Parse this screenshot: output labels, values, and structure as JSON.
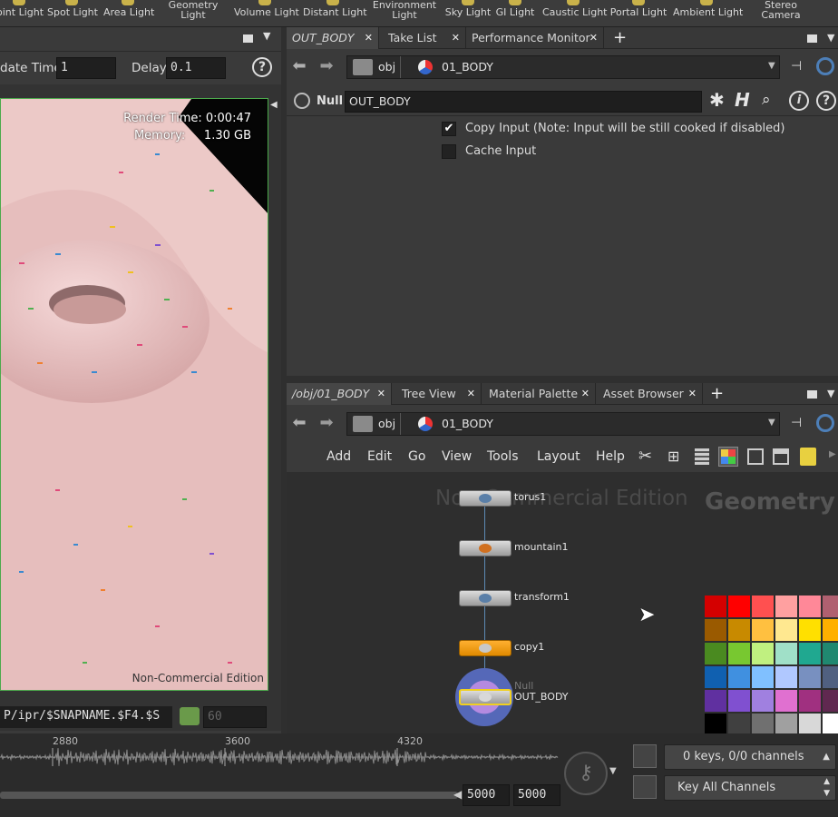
{
  "shelf": {
    "tools": [
      {
        "label": "Point Light",
        "visible": "oint Light"
      },
      {
        "label": "Spot Light"
      },
      {
        "label": "Area Light"
      },
      {
        "label": "Geometry Light",
        "l1": "Geometry",
        "l2": "Light"
      },
      {
        "label": "Volume Light"
      },
      {
        "label": "Distant Light"
      },
      {
        "label": "Environment Light",
        "l1": "Environment",
        "l2": "Light"
      },
      {
        "label": "Sky Light"
      },
      {
        "label": "GI Light"
      },
      {
        "label": "Caustic Light"
      },
      {
        "label": "Portal Light"
      },
      {
        "label": "Ambient Light"
      },
      {
        "label": "Stereo Camera",
        "l1": "Stereo",
        "l2": "Camera"
      }
    ]
  },
  "render": {
    "update_time_label": "date Time",
    "update_time_value": "1",
    "delay_label": "Delay",
    "delay_value": "0.1",
    "help_glyph": "?",
    "render_time_label": "Render Time:",
    "render_time_value": "0:00:47",
    "memory_label": "Memory:",
    "memory_value": "1.30 GB",
    "watermark": "Non-Commercial Edition",
    "output_path": "P/ipr/$SNAPNAME.$F4.$S",
    "frame_value": "60"
  },
  "top_pane": {
    "tabs": [
      {
        "label": "OUT_BODY",
        "active": true
      },
      {
        "label": "Take List"
      },
      {
        "label": "Performance Monitor"
      }
    ],
    "path": {
      "root": "obj",
      "node": "01_BODY"
    },
    "node_type": "Null",
    "node_name": "OUT_BODY",
    "params": [
      {
        "label": "Copy Input (Note: Input will be still cooked if disabled)",
        "checked": true
      },
      {
        "label": "Cache Input",
        "checked": false
      }
    ]
  },
  "bottom_pane": {
    "tabs": [
      {
        "label": "/obj/01_BODY",
        "active": true
      },
      {
        "label": "Tree View"
      },
      {
        "label": "Material Palette"
      },
      {
        "label": "Asset Browser"
      }
    ],
    "path": {
      "root": "obj",
      "node": "01_BODY"
    },
    "menu": [
      "Add",
      "Edit",
      "Go",
      "View",
      "Tools",
      "Layout",
      "Help"
    ],
    "watermark": "Non-Commercial Edition",
    "context_label": "Geometry",
    "nodes": [
      {
        "name": "torus1"
      },
      {
        "name": "mountain1"
      },
      {
        "name": "transform1"
      },
      {
        "name": "copy1"
      },
      {
        "name": "OUT_BODY",
        "type": "Null"
      }
    ],
    "palette_colors": [
      "#d40000",
      "#ff0000",
      "#ff5050",
      "#ffa0a0",
      "#ff8898",
      "#b06070",
      "#9a5a00",
      "#c88a00",
      "#ffc040",
      "#ffe890",
      "#ffe000",
      "#ffb000",
      "#4a8a20",
      "#78c830",
      "#c0f080",
      "#a0e0c8",
      "#20a890",
      "#208870",
      "#1060b0",
      "#4090e0",
      "#80c0ff",
      "#b0c8ff",
      "#7890c0",
      "#506080",
      "#6030a0",
      "#8050d0",
      "#a080e0",
      "#e070d0",
      "#a03080",
      "#602850",
      "#000000",
      "#404040",
      "#707070",
      "#a0a0a0",
      "#d8d8d8",
      "#ffffff"
    ]
  },
  "timeline": {
    "ticks": [
      "2880",
      "3600",
      "4320"
    ],
    "range_start": "5000",
    "range_end": "5000",
    "keys_label": "0 keys, 0/0 channels",
    "key_all_label": "Key All Channels"
  }
}
